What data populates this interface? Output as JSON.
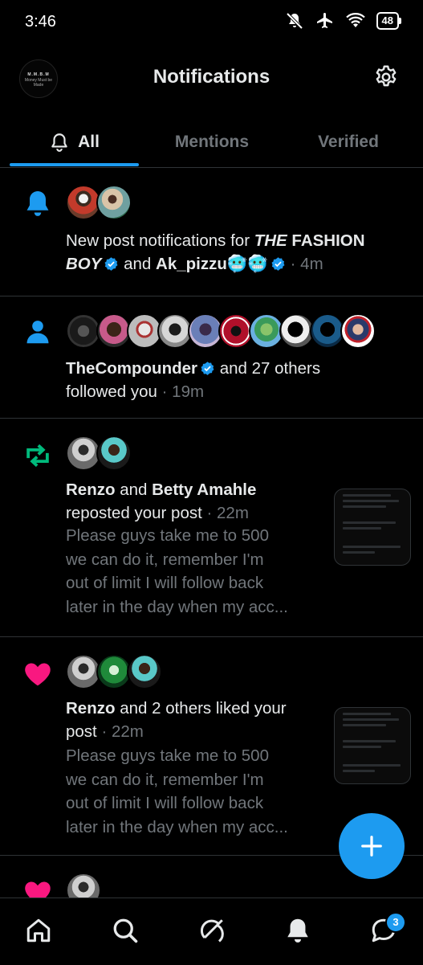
{
  "status": {
    "time": "3:46",
    "battery": "48"
  },
  "header": {
    "title": "Notifications",
    "avatar_line1": "M.M.B.M",
    "avatar_line2": "Money Must be Made"
  },
  "tabs": [
    {
      "label": "All"
    },
    {
      "label": "Mentions"
    },
    {
      "label": "Verified"
    }
  ],
  "notifications": [
    {
      "type": "bell-icon",
      "text_a": "New post notifications for ",
      "name1_italic": "THE",
      "name1_rest": " FASHION",
      "name1_line2": "BOY",
      "mid": " and ",
      "name2": "Ak_pizzu🥶🥶",
      "time": " · 4m"
    },
    {
      "type": "person-icon",
      "name": "TheCompounder",
      "rest": " and 27 others",
      "line2": "followed you",
      "time": " · 19m"
    },
    {
      "type": "repost-icon",
      "name1": "Renzo",
      "mid": " and ",
      "name2": "Betty Amahle",
      "line2": "reposted your post",
      "time": " · 22m",
      "preview": [
        "Please guys take me to 500",
        "we can do it, remember I'm",
        "out of limit I will follow back",
        "later in the day when my acc..."
      ]
    },
    {
      "type": "heart-icon",
      "name1": "Renzo",
      "rest": " and 2 others liked your",
      "line2": "post",
      "time": " · 22m",
      "preview": [
        "Please guys take me to 500",
        "we can do it, remember I'm",
        "out of limit I will follow back",
        "later in the day when my acc..."
      ]
    }
  ],
  "colors": {
    "accent": "#1d9bf0",
    "like": "#f91880",
    "repost": "#00ba7c",
    "muted": "#71767b",
    "background": "#000000"
  },
  "nav": {
    "messages_badge": "3"
  }
}
